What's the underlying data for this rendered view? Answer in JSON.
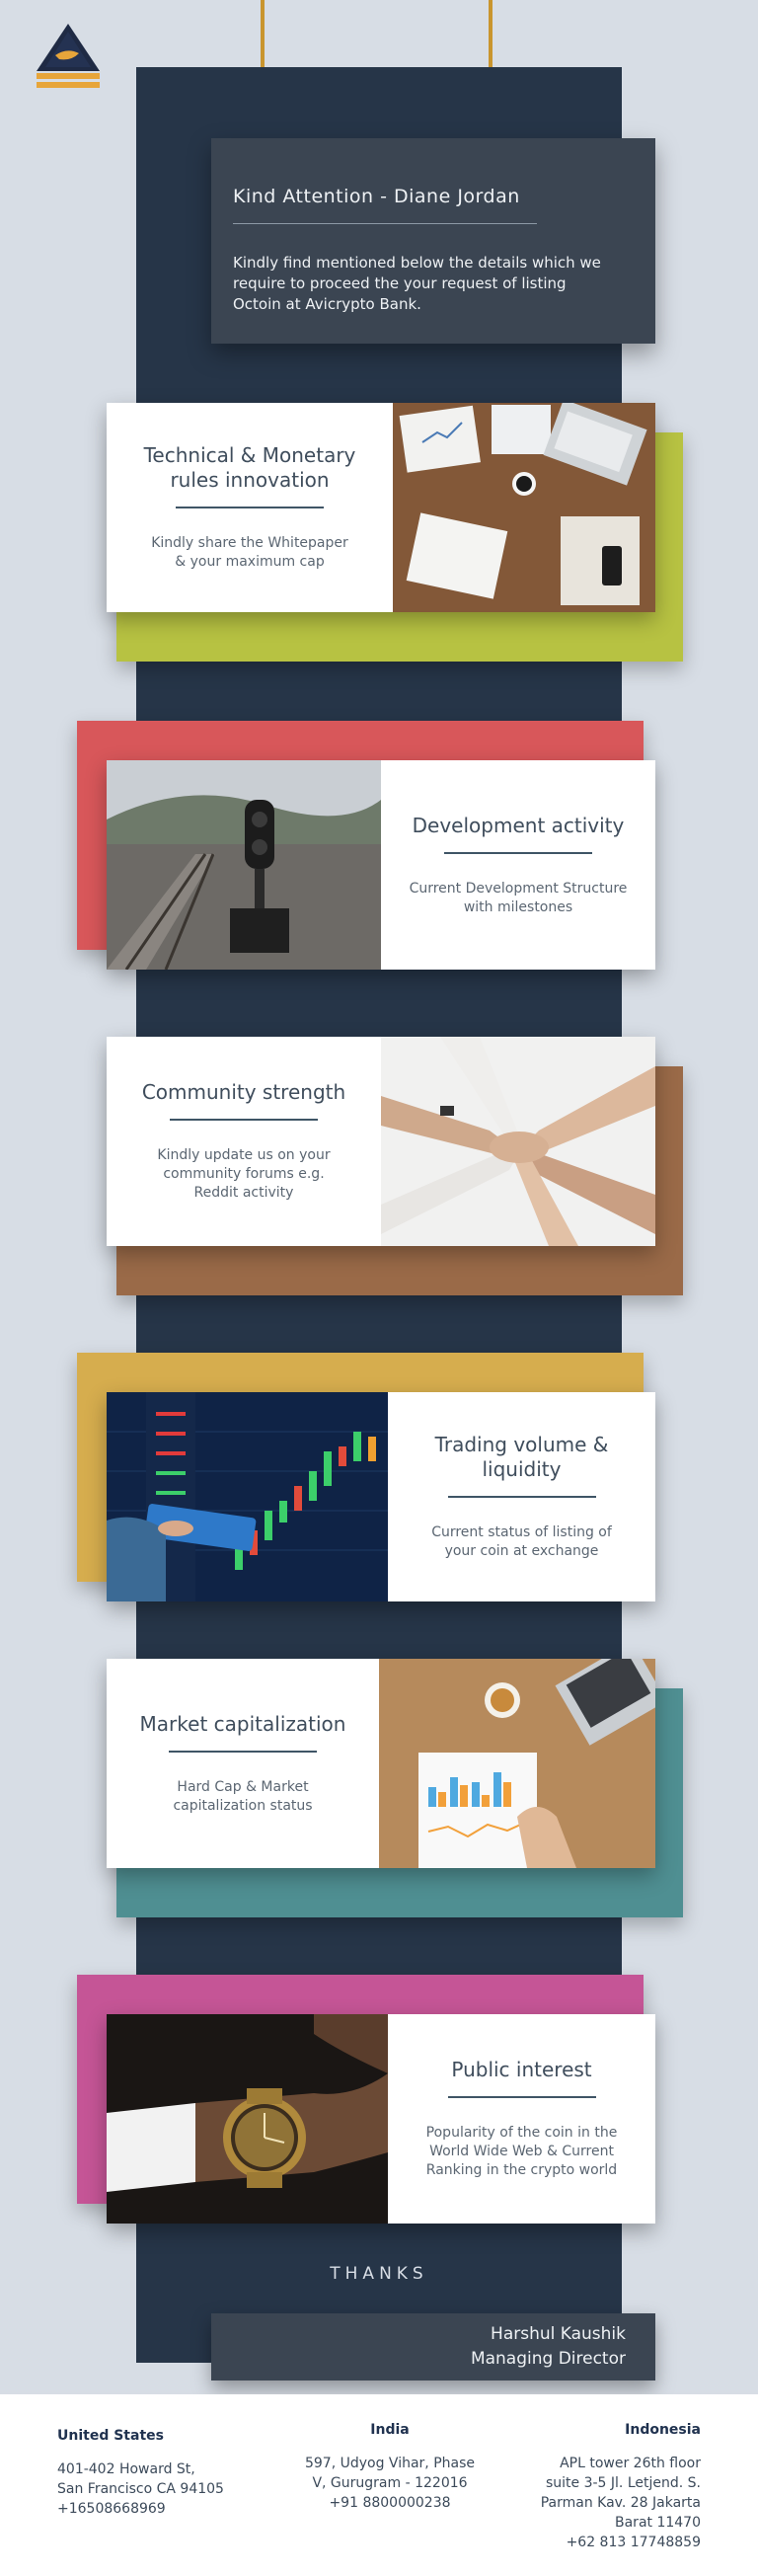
{
  "attention": {
    "title": "Kind Attention - Diane Jordan",
    "body": "Kindly find mentioned below the details which we require to proceed the your request of listing Octoin at Avicrypto Bank."
  },
  "colors": {
    "background": "#d7dde5",
    "spine": "#263548",
    "lime": "#b7c242",
    "red": "#d8575a",
    "brown": "#9a6a48",
    "mustard": "#d6ad4e",
    "teal": "#4f8f92",
    "magenta": "#c55596"
  },
  "cards": [
    {
      "title": "Technical & Monetary rules innovation",
      "desc": "Kindly share the Whitepaper & your maximum cap",
      "photo": "desk-laptop-papers-photo"
    },
    {
      "title": "Development activity",
      "desc": "Current Development Structure with milestones",
      "photo": "railway-signal-photo"
    },
    {
      "title": "Community strength",
      "desc": "Kindly update us on your community forums e.g. Reddit activity",
      "photo": "stacked-hands-photo"
    },
    {
      "title": "Trading volume & liquidity",
      "desc": "Current status of listing of your coin at exchange",
      "photo": "trading-chart-tablet-photo"
    },
    {
      "title": "Market capitalization",
      "desc": "Hard Cap & Market capitalization status",
      "photo": "charts-coffee-photo"
    },
    {
      "title": "Public interest",
      "desc": "Popularity of the coin in the World Wide Web & Current Ranking in the crypto world",
      "photo": "gold-watch-photo"
    }
  ],
  "thanks": "THANKS",
  "signature": {
    "name": "Harshul Kaushik",
    "role": "Managing Director"
  },
  "footer": {
    "us": {
      "heading": "United States",
      "lines": [
        "401-402 Howard St,",
        "San Francisco CA 94105",
        "+16508668969"
      ]
    },
    "india": {
      "heading": "India",
      "lines": [
        "597, Udyog Vihar, Phase",
        "V, Gurugram - 122016",
        "+91 8800000238"
      ]
    },
    "indonesia": {
      "heading": "Indonesia",
      "lines": [
        "APL tower 26th floor",
        "suite 3-5 Jl. Letjend. S.",
        "Parman Kav. 28 Jakarta",
        "Barat 11470",
        "+62 813 17748859"
      ]
    }
  }
}
